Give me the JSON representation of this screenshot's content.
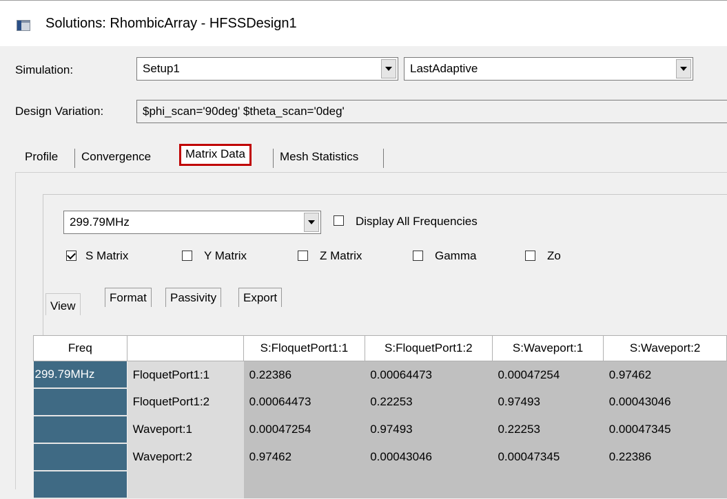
{
  "window": {
    "title": "Solutions: RhombicArray - HFSSDesign1"
  },
  "simulation": {
    "label": "Simulation:",
    "setup_value": "Setup1",
    "pass_value": "LastAdaptive"
  },
  "design_variation": {
    "label": "Design Variation:",
    "value": "$phi_scan='90deg' $theta_scan='0deg'"
  },
  "tabs": [
    {
      "label": "Profile",
      "selected": false
    },
    {
      "label": "Convergence",
      "selected": false
    },
    {
      "label": "Matrix Data",
      "selected": true
    },
    {
      "label": "Mesh Statistics",
      "selected": false
    }
  ],
  "matrix": {
    "frequency_value": "299.79MHz",
    "display_all_label": "Display All Frequencies",
    "display_all_checked": false,
    "options": [
      {
        "label": "S Matrix",
        "checked": true
      },
      {
        "label": "Y Matrix",
        "checked": false
      },
      {
        "label": "Z Matrix",
        "checked": false
      },
      {
        "label": "Gamma",
        "checked": false
      },
      {
        "label": "Zo",
        "checked": false
      }
    ],
    "subtabs": [
      "View",
      "Format",
      "Passivity",
      "Export"
    ]
  },
  "grid": {
    "headers": [
      "Freq",
      "",
      "S:FloquetPort1:1",
      "S:FloquetPort1:2",
      "S:Waveport:1",
      "S:Waveport:2"
    ],
    "rows": [
      {
        "freq": "299.79MHz",
        "port": "FloquetPort1:1",
        "values": [
          "0.22386",
          "0.00064473",
          "0.00047254",
          "0.97462"
        ]
      },
      {
        "freq": "",
        "port": "FloquetPort1:2",
        "values": [
          "0.00064473",
          "0.22253",
          "0.97493",
          "0.00043046"
        ]
      },
      {
        "freq": "",
        "port": "Waveport:1",
        "values": [
          "0.00047254",
          "0.97493",
          "0.22253",
          "0.00047345"
        ]
      },
      {
        "freq": "",
        "port": "Waveport:2",
        "values": [
          "0.97462",
          "0.00043046",
          "0.00047345",
          "0.22386"
        ]
      },
      {
        "freq": "",
        "port": "",
        "values": [
          "",
          "",
          "",
          ""
        ]
      }
    ]
  },
  "colors": {
    "freq_cell_bg": "#3f6a84",
    "data_cell_bg": "#c0c0c0",
    "selected_tab_outline": "#c00000"
  }
}
